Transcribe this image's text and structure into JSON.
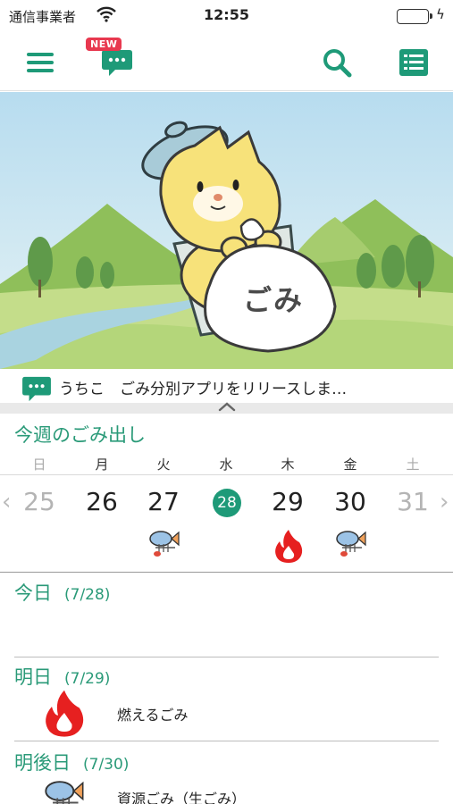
{
  "status_bar": {
    "carrier": "通信事業者",
    "time": "12:55"
  },
  "header": {
    "new_badge": "NEW"
  },
  "ticker": {
    "text": "うちこ　ごみ分別アプリをリリースしま…"
  },
  "hero": {
    "bag_text": "ごみ"
  },
  "week": {
    "title": "今週のごみ出し",
    "weekdays": [
      "日",
      "月",
      "火",
      "水",
      "木",
      "金",
      "土"
    ],
    "days": [
      "25",
      "26",
      "27",
      "28",
      "29",
      "30",
      "31"
    ],
    "today_index": 3,
    "day_icons": [
      "",
      "",
      "fish-bone-icon",
      "",
      "fire-icon",
      "fish-bone-icon",
      ""
    ]
  },
  "schedule": [
    {
      "label": "今日",
      "date": "(7/28)",
      "item": ""
    },
    {
      "label": "明日",
      "date": "(7/29)",
      "item": "燃えるごみ",
      "icon": "fire-icon"
    },
    {
      "label": "明後日",
      "date": "(7/30)",
      "item": "資源ごみ（生ごみ）",
      "icon": "fish-bone-icon"
    }
  ],
  "colors": {
    "accent": "#2a9a78",
    "fire": "#e62020",
    "badge": "#e8384f"
  }
}
